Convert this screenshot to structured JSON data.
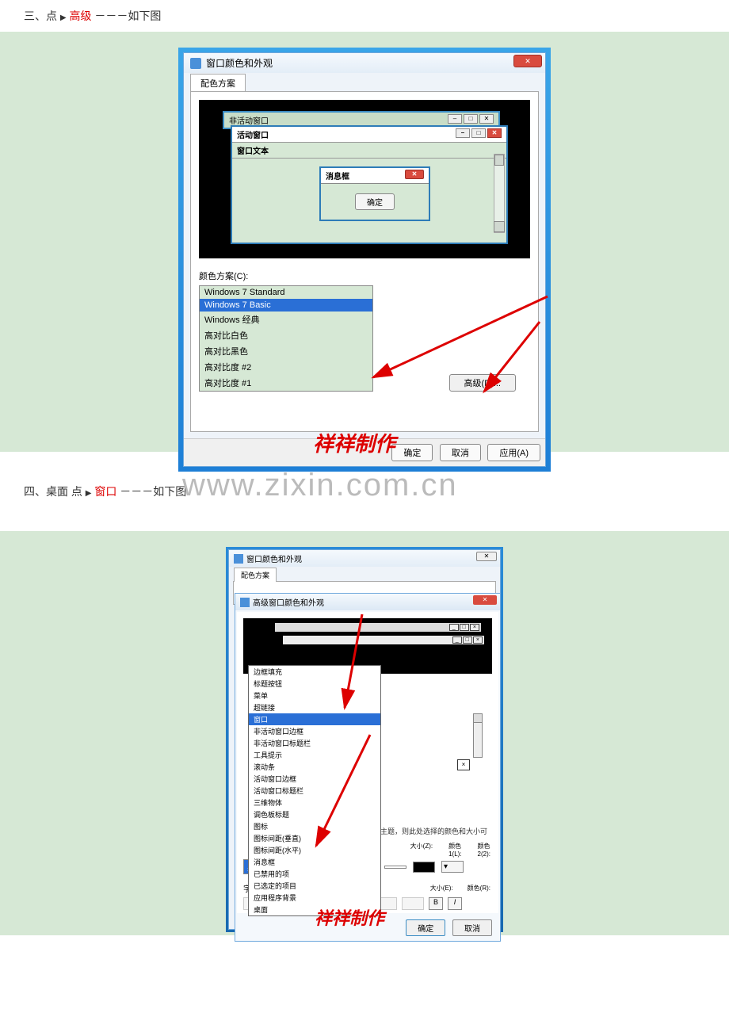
{
  "step3": {
    "prefix": "三、点",
    "highlight": "高级",
    "suffix": "－－－如下图"
  },
  "step4": {
    "prefix": "四、桌面  点",
    "highlight": "窗口",
    "suffix": "－－－如下图"
  },
  "watermark": "www.zixin.com.cn",
  "stamp": "祥祥制作",
  "shot1": {
    "window_title": "窗口颜色和外观",
    "close_x": "✕",
    "tab": "配色方案",
    "preview": {
      "inactive": "非活动窗口",
      "active": "活动窗口",
      "window_text": "窗口文本",
      "msgbox_title": "消息框",
      "msgbox_ok": "确定"
    },
    "scheme_label": "颜色方案(C):",
    "schemes": [
      "Windows 7 Standard",
      "Windows 7 Basic",
      "Windows 经典",
      "高对比白色",
      "高对比黑色",
      "高对比度 #2",
      "高对比度 #1"
    ],
    "advanced_btn": "高级(D)...",
    "ok": "确定",
    "cancel": "取消",
    "apply": "应用(A)"
  },
  "shot2": {
    "outer_title": "窗口颜色和外观",
    "outer_tab": "配色方案",
    "adv_title": "高级窗口颜色和外观",
    "items": [
      "边框填充",
      "标题按钮",
      "菜单",
      "超链接",
      "窗口",
      "非活动窗口边框",
      "非活动窗口标题栏",
      "工具提示",
      "滚动条",
      "活动窗口边框",
      "活动窗口标题栏",
      "三维物体",
      "调色板标题",
      "图标",
      "图标间距(垂直)",
      "图标间距(水平)",
      "消息框",
      "已禁用的项",
      "已选定的项目",
      "应用程序背景",
      "桌面"
    ],
    "selected_bottom": "桌面",
    "hint": "主题，则此处选择的颜色和大小可",
    "labels": {
      "size_z": "大小(Z):",
      "color1": "颜色",
      "color1_l": "1(L):",
      "color2": "颜色",
      "color2_2": "2(2):",
      "font_f": "字体(F):",
      "size_e": "大小(E):",
      "color_r": "颜色(R):",
      "b": "B",
      "i": "I"
    },
    "ok": "确定",
    "cancel": "取消",
    "x": "×"
  }
}
